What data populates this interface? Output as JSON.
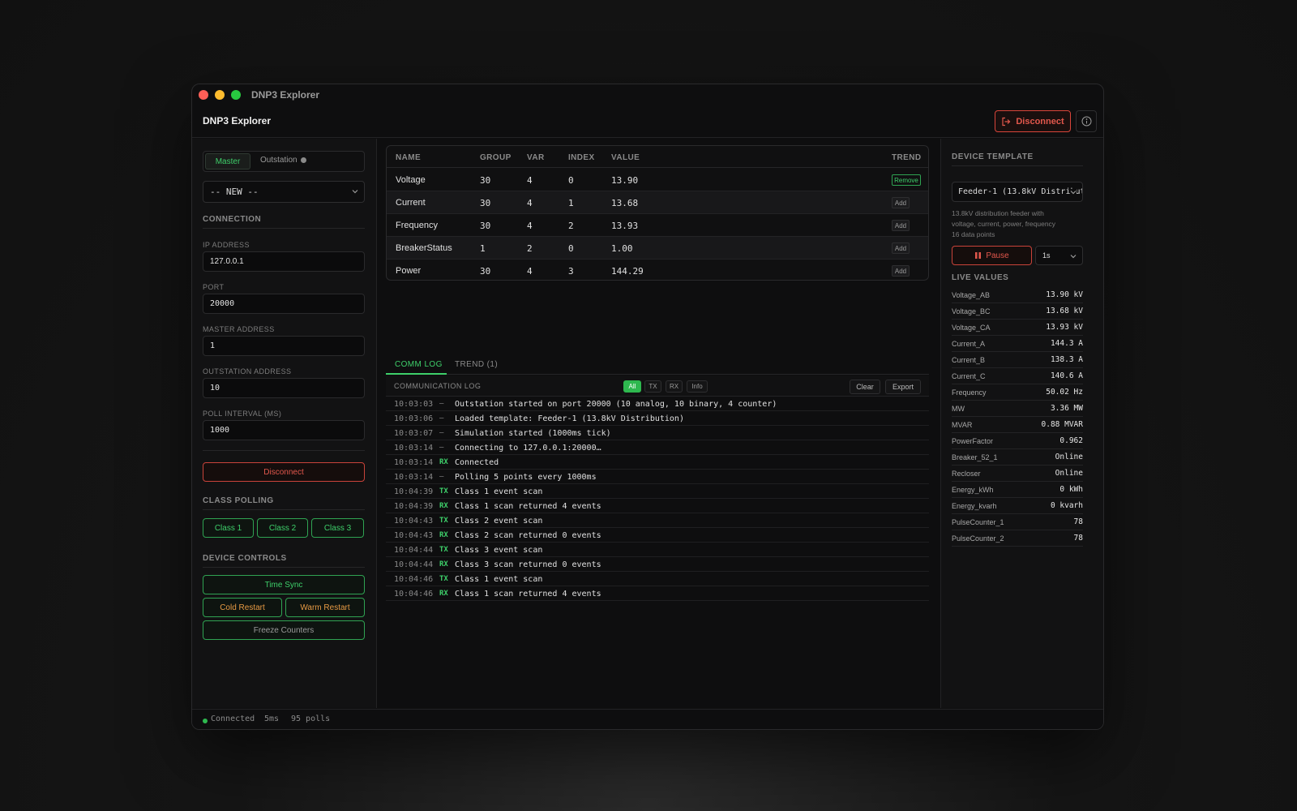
{
  "window": {
    "title": "DNP3 Explorer"
  },
  "header": {
    "app_name": "DNP3 Explorer",
    "disconnect_label": "Disconnect"
  },
  "left": {
    "mode_master": "Master",
    "mode_outstation": "Outstation",
    "session_select": "-- NEW --",
    "connection_title": "CONNECTION",
    "ip_label": "IP ADDRESS",
    "ip_value": "127.0.0.1",
    "port_label": "PORT",
    "port_value": "20000",
    "master_addr_label": "MASTER ADDRESS",
    "master_addr_value": "1",
    "outstation_addr_label": "OUTSTATION ADDRESS",
    "outstation_addr_value": "10",
    "poll_label": "POLL INTERVAL (MS)",
    "poll_value": "1000",
    "disconnect_label": "Disconnect",
    "class_polling_title": "CLASS POLLING",
    "class1": "Class 1",
    "class2": "Class 2",
    "class3": "Class 3",
    "device_controls_title": "DEVICE CONTROLS",
    "time_sync": "Time Sync",
    "cold_restart": "Cold Restart",
    "warm_restart": "Warm Restart",
    "freeze_counters": "Freeze Counters"
  },
  "points": {
    "headers": {
      "name": "NAME",
      "group": "GROUP",
      "var": "VAR",
      "index": "INDEX",
      "value": "VALUE",
      "trend": "TREND"
    },
    "rows": [
      {
        "name": "Voltage",
        "group": "30",
        "var": "4",
        "index": "0",
        "value": "13.90",
        "trend": "Remove"
      },
      {
        "name": "Current",
        "group": "30",
        "var": "4",
        "index": "1",
        "value": "13.68",
        "trend": "Add"
      },
      {
        "name": "Frequency",
        "group": "30",
        "var": "4",
        "index": "2",
        "value": "13.93",
        "trend": "Add"
      },
      {
        "name": "BreakerStatus",
        "group": "1",
        "var": "2",
        "index": "0",
        "value": "1.00",
        "trend": "Add"
      },
      {
        "name": "Power",
        "group": "30",
        "var": "4",
        "index": "3",
        "value": "144.29",
        "trend": "Add"
      }
    ]
  },
  "tabs": {
    "comm_log": "COMM LOG",
    "trend": "TREND (1)"
  },
  "log": {
    "title": "COMMUNICATION LOG",
    "filters": {
      "all": "All",
      "tx": "TX",
      "rx": "RX",
      "info": "Info"
    },
    "clear": "Clear",
    "export": "Export",
    "entries": [
      {
        "time": "10:03:03",
        "dir": "—",
        "msg": "Outstation started on port 20000 (10 analog, 10 binary, 4 counter)"
      },
      {
        "time": "10:03:06",
        "dir": "—",
        "msg": "Loaded template: Feeder-1 (13.8kV Distribution)"
      },
      {
        "time": "10:03:07",
        "dir": "—",
        "msg": "Simulation started (1000ms tick)"
      },
      {
        "time": "10:03:14",
        "dir": "—",
        "msg": "Connecting to 127.0.0.1:20000…"
      },
      {
        "time": "10:03:14",
        "dir": "RX",
        "msg": "Connected"
      },
      {
        "time": "10:03:14",
        "dir": "—",
        "msg": "Polling 5 points every 1000ms"
      },
      {
        "time": "10:04:39",
        "dir": "TX",
        "msg": "Class 1 event scan"
      },
      {
        "time": "10:04:39",
        "dir": "RX",
        "msg": "Class 1 scan returned 4 events"
      },
      {
        "time": "10:04:43",
        "dir": "TX",
        "msg": "Class 2 event scan"
      },
      {
        "time": "10:04:43",
        "dir": "RX",
        "msg": "Class 2 scan returned 0 events"
      },
      {
        "time": "10:04:44",
        "dir": "TX",
        "msg": "Class 3 event scan"
      },
      {
        "time": "10:04:44",
        "dir": "RX",
        "msg": "Class 3 scan returned 0 events"
      },
      {
        "time": "10:04:46",
        "dir": "TX",
        "msg": "Class 1 event scan"
      },
      {
        "time": "10:04:46",
        "dir": "RX",
        "msg": "Class 1 scan returned 4 events"
      }
    ]
  },
  "right": {
    "template_title": "DEVICE TEMPLATE",
    "template_select": "Feeder-1 (13.8kV Distribution)",
    "desc_line1": "13.8kV distribution feeder with",
    "desc_line2": "voltage, current, power, frequency",
    "desc_line3": "16 data points",
    "pause": "Pause",
    "rate": "1s",
    "live_title": "LIVE VALUES",
    "live": [
      {
        "name": "Voltage_AB",
        "value": "13.90 kV"
      },
      {
        "name": "Voltage_BC",
        "value": "13.68 kV"
      },
      {
        "name": "Voltage_CA",
        "value": "13.93 kV"
      },
      {
        "name": "Current_A",
        "value": "144.3 A"
      },
      {
        "name": "Current_B",
        "value": "138.3 A"
      },
      {
        "name": "Current_C",
        "value": "140.6 A"
      },
      {
        "name": "Frequency",
        "value": "50.02 Hz"
      },
      {
        "name": "MW",
        "value": "3.36 MW"
      },
      {
        "name": "MVAR",
        "value": "0.88 MVAR"
      },
      {
        "name": "PowerFactor",
        "value": "0.962"
      },
      {
        "name": "Breaker_52_1",
        "value": "Online"
      },
      {
        "name": "Recloser",
        "value": "Online"
      },
      {
        "name": "Energy_kWh",
        "value": "0 kWh"
      },
      {
        "name": "Energy_kvarh",
        "value": "0 kvarh"
      },
      {
        "name": "PulseCounter_1",
        "value": "78"
      },
      {
        "name": "PulseCounter_2",
        "value": "78"
      }
    ]
  },
  "status": {
    "connection": "Connected",
    "latency": "5ms",
    "polls": "95 polls"
  },
  "colors": {
    "accent_green": "#3ecf6a",
    "danger_red": "#e2574c",
    "warning_orange": "#e79a44"
  }
}
